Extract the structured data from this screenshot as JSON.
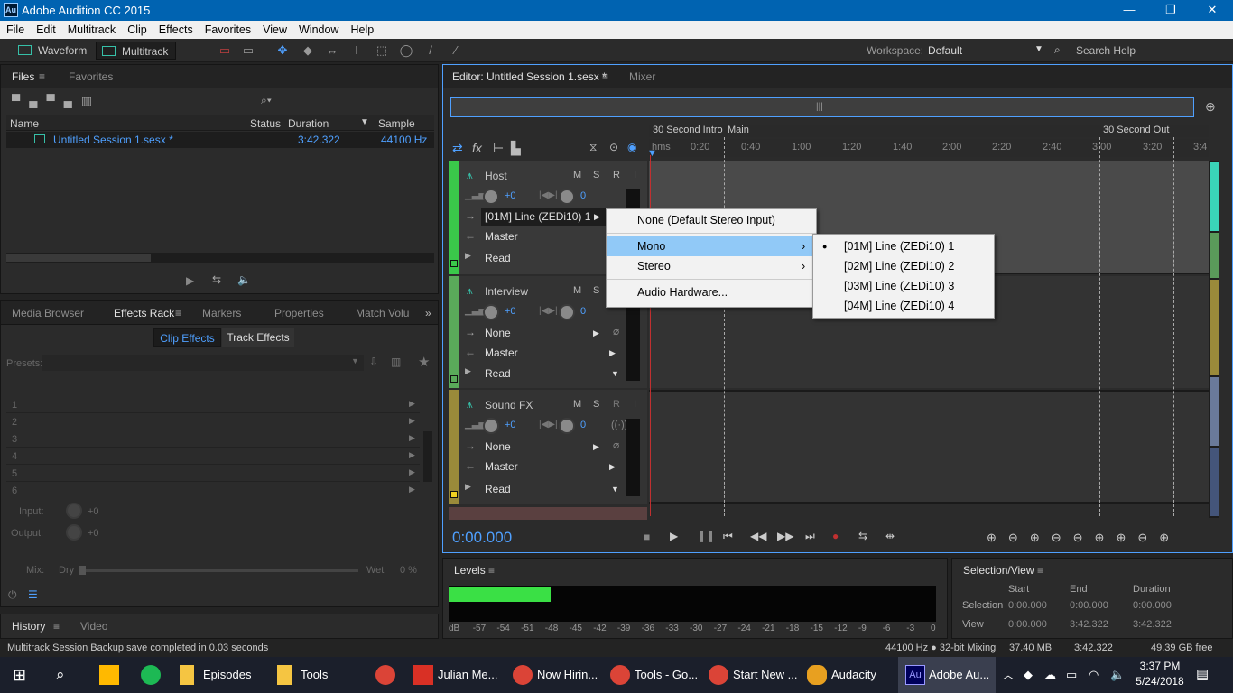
{
  "window": {
    "title": "Adobe Audition CC 2015",
    "minimize": "—",
    "restore": "❐",
    "close": "✕",
    "logo": "Au"
  },
  "menu": [
    "File",
    "Edit",
    "Multitrack",
    "Clip",
    "Effects",
    "Favorites",
    "View",
    "Window",
    "Help"
  ],
  "toolbar": {
    "waveform_label": "Waveform",
    "multitrack_label": "Multitrack",
    "workspace_label": "Workspace:",
    "workspace_value": "Default",
    "search_placeholder": "Search Help"
  },
  "files_panel": {
    "tabs": [
      "Files",
      "Favorites"
    ],
    "columns": [
      "Name",
      "Status",
      "Duration",
      "Sample Rate"
    ],
    "rows": [
      {
        "name": "Untitled Session 1.sesx *",
        "status": "",
        "duration": "3:42.322",
        "sample_rate": "44100 Hz"
      }
    ]
  },
  "effects_panel": {
    "tabs": [
      "Media Browser",
      "Effects Rack",
      "Markers",
      "Properties",
      "Match Volu"
    ],
    "subtabs": [
      "Clip Effects",
      "Track Effects"
    ],
    "presets_label": "Presets:",
    "slots": [
      "1",
      "2",
      "3",
      "4",
      "5",
      "6"
    ],
    "input_label": "Input:",
    "input_value": "+0",
    "output_label": "Output:",
    "output_value": "+0",
    "mix_label": "Mix:",
    "dry_label": "Dry",
    "wet_label": "Wet",
    "wet_value": "0 %"
  },
  "history_panel": {
    "tabs": [
      "History",
      "Video"
    ]
  },
  "editor": {
    "tabs": [
      "Editor: Untitled Session 1.sesx *",
      "Mixer"
    ],
    "markers": [
      "30 Second Intro",
      "Main",
      "30 Second Out"
    ],
    "ruler": [
      "hms",
      "0:20",
      "0:40",
      "1:00",
      "1:20",
      "1:40",
      "2:00",
      "2:20",
      "2:40",
      "3:00",
      "3:20",
      "3:4"
    ],
    "time": "0:00.000",
    "tracks": [
      {
        "name": "Host",
        "volume": "+0",
        "pan": "0",
        "input": "[01M] Line (ZEDi10) 1",
        "output": "Master",
        "automation": "Read",
        "color": "#3ac84a",
        "buttons": [
          "M",
          "S",
          "R",
          "I"
        ]
      },
      {
        "name": "Interview",
        "volume": "+0",
        "pan": "0",
        "input": "None",
        "output": "Master",
        "automation": "Read",
        "color": "#5aaa5a",
        "buttons": [
          "M",
          "S",
          "R",
          "I"
        ]
      },
      {
        "name": "Sound FX",
        "volume": "+0",
        "pan": "0",
        "input": "None",
        "output": "Master",
        "automation": "Read",
        "color": "#c8b432",
        "buttons": [
          "M",
          "S",
          "R",
          "I"
        ]
      }
    ]
  },
  "input_menu": {
    "items": [
      "None (Default Stereo Input)",
      "Mono",
      "Stereo",
      "Audio Hardware..."
    ],
    "highlighted": "Mono",
    "submenu": [
      "[01M] Line (ZEDi10) 1",
      "[02M] Line (ZEDi10) 2",
      "[03M] Line (ZEDi10) 3",
      "[04M] Line (ZEDi10) 4"
    ],
    "selected": "[01M] Line (ZEDi10) 1"
  },
  "levels": {
    "title": "Levels",
    "scale": [
      "dB",
      "-57",
      "-54",
      "-51",
      "-48",
      "-45",
      "-42",
      "-39",
      "-36",
      "-33",
      "-30",
      "-27",
      "-24",
      "-21",
      "-18",
      "-15",
      "-12",
      "-9",
      "-6",
      "-3",
      "0"
    ],
    "level_fraction": 0.21
  },
  "selection_view": {
    "title": "Selection/View",
    "headers": [
      "Start",
      "End",
      "Duration"
    ],
    "rows": [
      {
        "label": "Selection",
        "start": "0:00.000",
        "end": "0:00.000",
        "duration": "0:00.000"
      },
      {
        "label": "View",
        "start": "0:00.000",
        "end": "3:42.322",
        "duration": "3:42.322"
      }
    ]
  },
  "status_bar": {
    "message": "Multitrack Session Backup save completed in 0.03 seconds",
    "format": "44100 Hz ● 32-bit Mixing",
    "memory": "37.40 MB",
    "duration": "3:42.322",
    "free": "49.39 GB free"
  },
  "taskbar": {
    "apps": [
      "Episodes",
      "Tools",
      "Julian Me...",
      "Now Hirin...",
      "Tools - Go...",
      "Start New ...",
      "Audacity",
      "Adobe Au..."
    ],
    "time": "3:37 PM",
    "date": "5/24/2018"
  },
  "colors": {
    "accent": "#4fa0ff",
    "menu_highlight": "#91c9f7",
    "title_bar": "#0063b1",
    "level_green": "#3ae045"
  }
}
